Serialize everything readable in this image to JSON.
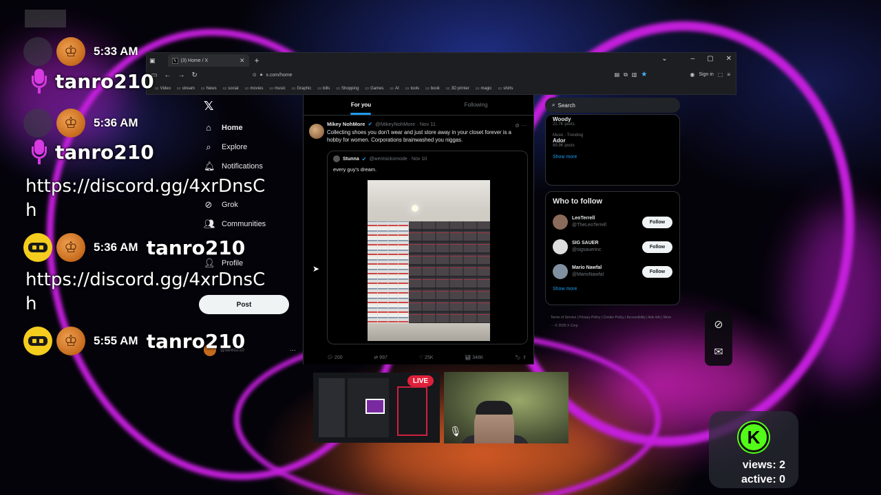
{
  "chat": {
    "messages": [
      {
        "time": "5:33 AM",
        "user": "tanro210"
      },
      {
        "time": "5:36 AM",
        "user": "tanro210",
        "text": "https://discord.gg/4xrDnsCh"
      },
      {
        "time": "5:36 AM",
        "user": "tanro210",
        "text": "https://discord.gg/4xrDnsCh"
      },
      {
        "time": "5:55 AM",
        "user": "tanro210"
      }
    ]
  },
  "browser": {
    "tab_title": "(3) Home / X",
    "url": "x.com/home",
    "sign_in": "Sign in",
    "bookmarks": [
      "Video",
      "stream",
      "News",
      "social",
      "movies",
      "music",
      "Graphic",
      "bills",
      "Shopping",
      "Games",
      "AI",
      "tools",
      "book",
      "3D printer",
      "magic",
      "shirts"
    ]
  },
  "x": {
    "nav": [
      {
        "label": "Home",
        "icon": "home-icon"
      },
      {
        "label": "Explore",
        "icon": "search-icon"
      },
      {
        "label": "Notifications",
        "icon": "bell-icon"
      },
      {
        "label": "Grok",
        "icon": "grok-icon"
      },
      {
        "label": "Communities",
        "icon": "people-icon"
      },
      {
        "label": "Profile",
        "icon": "person-icon"
      }
    ],
    "post_label": "Post",
    "profile_handle": "@tanro210",
    "feed_tabs": [
      "For you",
      "Following"
    ],
    "tweet": {
      "name": "Mikey NohMore",
      "handle": "@MikeyNohMore · Nov 11",
      "text": "Collecting shoes you don't wear and just store away in your closet forever is a hobby for women. Corporations brainwashed you niggas.",
      "quote_name": "Stunna",
      "quote_handle": "@wentsickomode · Nov 10",
      "quote_text": "every guy's dream.",
      "replies": "200",
      "reposts": "997",
      "likes": "25K",
      "views": "348K"
    },
    "search_placeholder": "Search",
    "trends": [
      {
        "category": "",
        "name": "Woody",
        "count": "22.7K posts"
      },
      {
        "category": "Music · Trending",
        "name": "Ador",
        "count": "89.9K posts"
      }
    ],
    "show_more": "Show more",
    "who_to_follow": "Who to follow",
    "follow_label": "Follow",
    "suggestions": [
      {
        "name": "LeoTerrell",
        "handle": "@TheLeoTerrell"
      },
      {
        "name": "SIG SAUER",
        "handle": "@sigsauerinc"
      },
      {
        "name": "Mario Nawfal",
        "handle": "@MarioNawfal"
      }
    ],
    "footer": "Terms of Service | Privacy Policy | Cookie Policy | Accessibility | Ads info | More ··· © 2025 X Corp."
  },
  "stream": {
    "live_label": "LIVE",
    "views": "views: 2",
    "active": "active: 0",
    "kick_letter": "K"
  },
  "colors": {
    "accent": "#1d9bf0",
    "live": "#e0203a",
    "kick": "#53fc18",
    "mic": "#d63ae0"
  }
}
